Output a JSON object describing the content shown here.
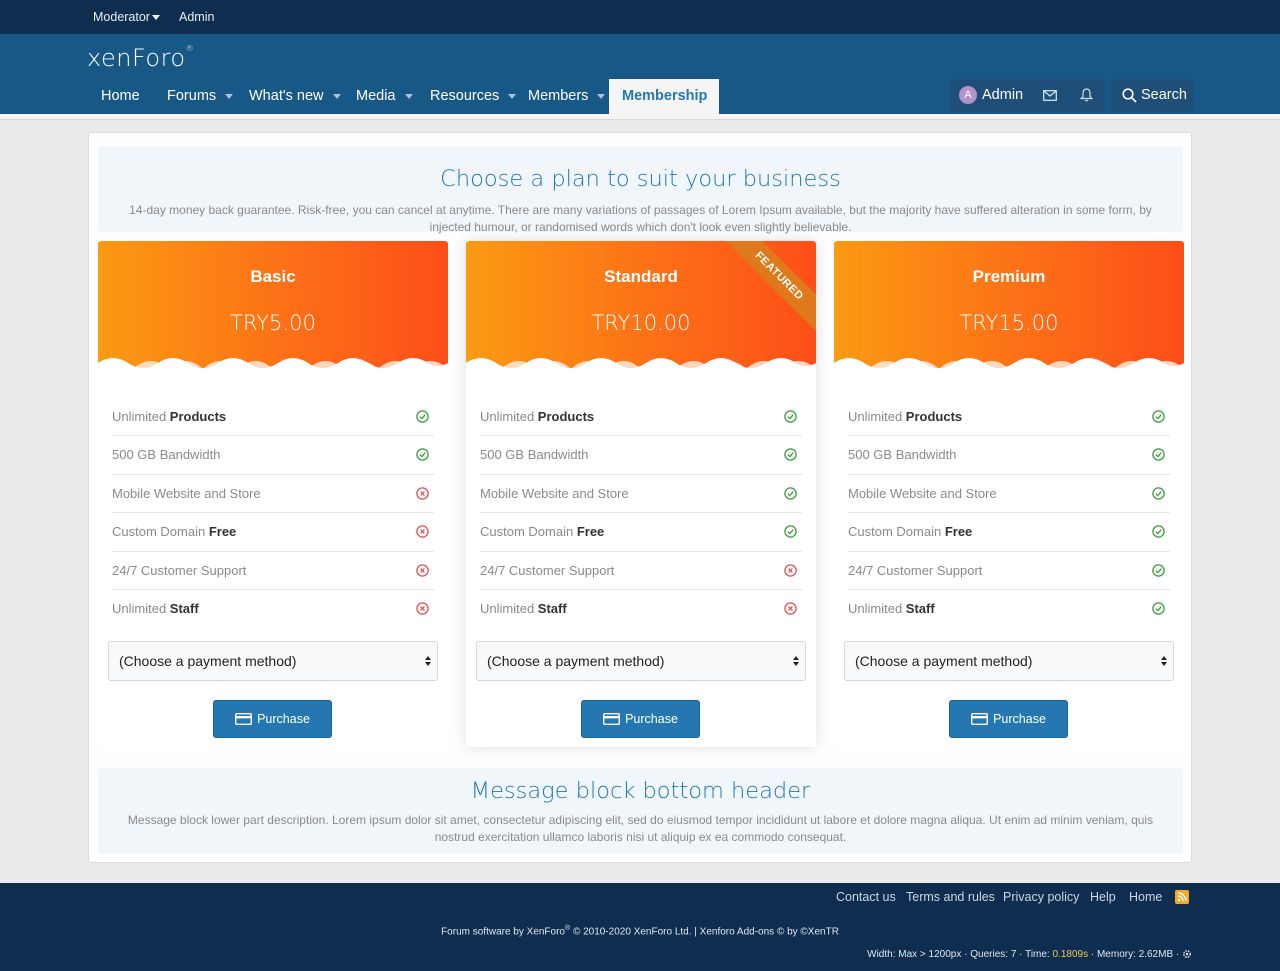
{
  "staffbar": {
    "moderator": "Moderator",
    "admin": "Admin"
  },
  "header": {
    "logo": "xenForo"
  },
  "nav": {
    "home": "Home",
    "forums": "Forums",
    "whats_new": "What's new",
    "media": "Media",
    "resources": "Resources",
    "members": "Members",
    "membership": "Membership"
  },
  "account": {
    "avatar_letter": "A",
    "name": "Admin",
    "search": "Search"
  },
  "top_message": {
    "title": "Choose a plan to suit your business",
    "description": "14-day money back guarantee. Risk-free, you can cancel at anytime. There are many variations of passages of Lorem Ipsum available, but the majority have suffered alteration in some form, by injected humour, or randomised words which don't look even slightly believable."
  },
  "plans": [
    {
      "name": "Basic",
      "price": "TRY5.00",
      "features": [
        {
          "text": "Unlimited ",
          "bold": "Products",
          "included": true
        },
        {
          "text": "500 GB Bandwidth",
          "bold": "",
          "included": true
        },
        {
          "text": "Mobile Website and Store",
          "bold": "",
          "included": false
        },
        {
          "text": "Custom Domain ",
          "bold": "Free",
          "included": false
        },
        {
          "text": "24/7 Customer Support",
          "bold": "",
          "included": false
        },
        {
          "text": "Unlimited ",
          "bold": "Staff",
          "included": false
        }
      ],
      "payment_placeholder": "(Choose a payment method)",
      "button": "Purchase"
    },
    {
      "name": "Standard",
      "price": "TRY10.00",
      "ribbon": "FEATURED",
      "features": [
        {
          "text": "Unlimited ",
          "bold": "Products",
          "included": true
        },
        {
          "text": "500 GB Bandwidth",
          "bold": "",
          "included": true
        },
        {
          "text": "Mobile Website and Store",
          "bold": "",
          "included": true
        },
        {
          "text": "Custom Domain ",
          "bold": "Free",
          "included": true
        },
        {
          "text": "24/7 Customer Support",
          "bold": "",
          "included": false
        },
        {
          "text": "Unlimited ",
          "bold": "Staff",
          "included": false
        }
      ],
      "payment_placeholder": "(Choose a payment method)",
      "button": "Purchase"
    },
    {
      "name": "Premium",
      "price": "TRY15.00",
      "features": [
        {
          "text": "Unlimited ",
          "bold": "Products",
          "included": true
        },
        {
          "text": "500 GB Bandwidth",
          "bold": "",
          "included": true
        },
        {
          "text": "Mobile Website and Store",
          "bold": "",
          "included": true
        },
        {
          "text": "Custom Domain ",
          "bold": "Free",
          "included": true
        },
        {
          "text": "24/7 Customer Support",
          "bold": "",
          "included": true
        },
        {
          "text": "Unlimited ",
          "bold": "Staff",
          "included": true
        }
      ],
      "payment_placeholder": "(Choose a payment method)",
      "button": "Purchase"
    }
  ],
  "bottom_message": {
    "title": "Message block bottom header",
    "description": "Message block lower part description. Lorem ipsum dolor sit amet, consectetur adipiscing elit, sed do eiusmod tempor incididunt ut labore et dolore magna aliqua. Ut enim ad minim veniam, quis nostrud exercitation ullamco laboris nisi ut aliquip ex ea commodo consequat."
  },
  "footer": {
    "links": [
      "Contact us",
      "Terms and rules",
      "Privacy policy",
      "Help",
      "Home"
    ],
    "copyright_pre": "Forum software by XenForo",
    "copyright_post": " © 2010-2020 XenForo Ltd. | Xenforo Add-ons © by ©XenTR",
    "debug_pre": "Width: Max > 1200px · Queries: 7 · Time: ",
    "debug_time": "0.1809s",
    "debug_post": " · Memory: 2.62MB · "
  },
  "colors": {
    "header": "#185886",
    "staffbar": "#0f2d4e",
    "accent": "#2577b1",
    "card_orange": "#fd6f17",
    "check": "#3c9c3c",
    "cross": "#e05050"
  }
}
